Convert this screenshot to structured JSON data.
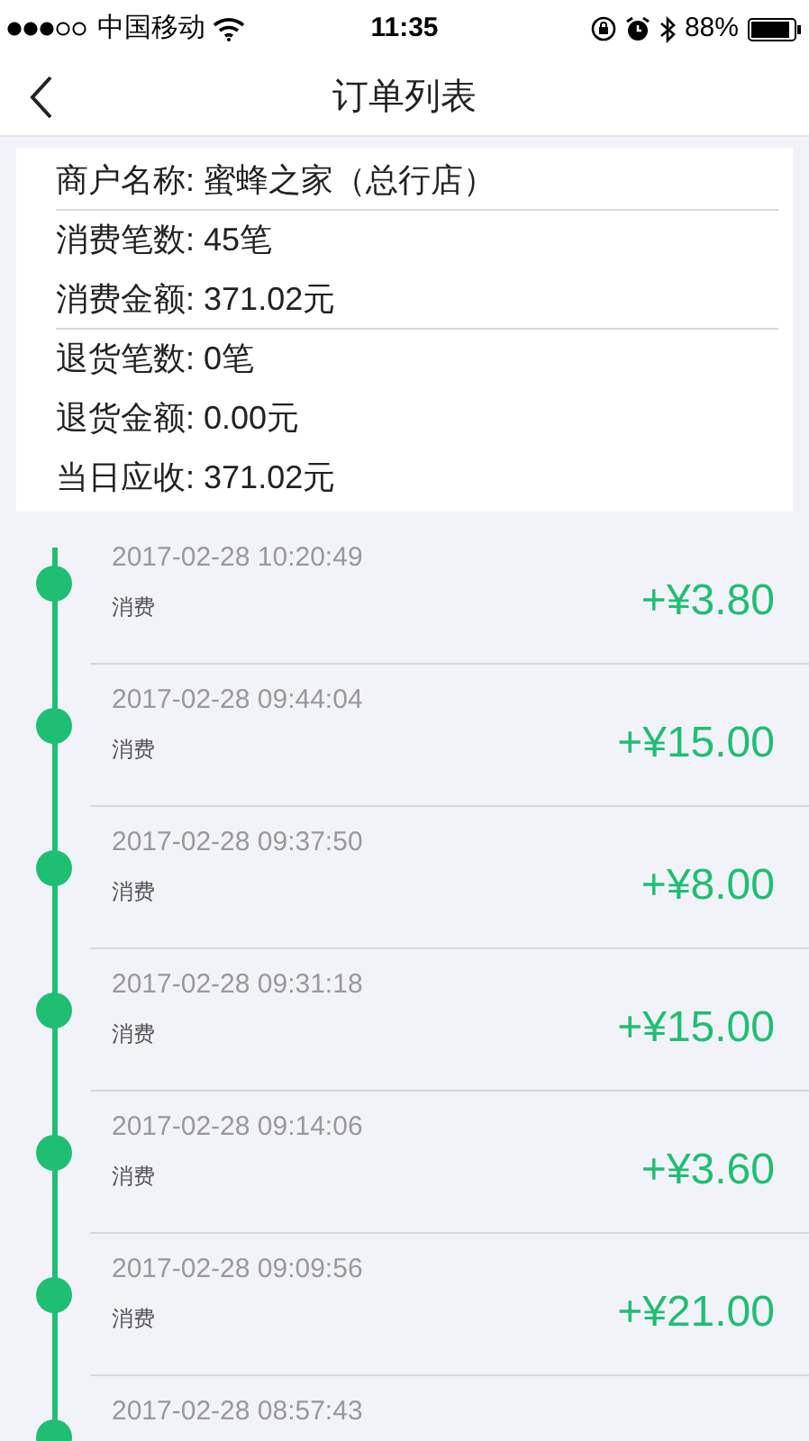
{
  "status_bar": {
    "carrier": "中国移动",
    "time": "11:35",
    "battery": "88%"
  },
  "nav": {
    "title": "订单列表"
  },
  "summary": [
    {
      "label": "商户名称:",
      "value": "蜜蜂之家（总行店）",
      "divider_after": true
    },
    {
      "label": "消费笔数:",
      "value": "45笔",
      "divider_after": false
    },
    {
      "label": "消费金额:",
      "value": "371.02元",
      "divider_after": true
    },
    {
      "label": "退货笔数:",
      "value": "0笔",
      "divider_after": false
    },
    {
      "label": "退货金额:",
      "value": "0.00元",
      "divider_after": false
    },
    {
      "label": "当日应收:",
      "value": "371.02元",
      "divider_after": false
    }
  ],
  "orders": [
    {
      "time": "2017-02-28 10:20:49",
      "type": "消费",
      "amount": "+¥3.80"
    },
    {
      "time": "2017-02-28 09:44:04",
      "type": "消费",
      "amount": "+¥15.00"
    },
    {
      "time": "2017-02-28 09:37:50",
      "type": "消费",
      "amount": "+¥8.00"
    },
    {
      "time": "2017-02-28 09:31:18",
      "type": "消费",
      "amount": "+¥15.00"
    },
    {
      "time": "2017-02-28 09:14:06",
      "type": "消费",
      "amount": "+¥3.60"
    },
    {
      "time": "2017-02-28 09:09:56",
      "type": "消费",
      "amount": "+¥21.00"
    },
    {
      "time": "2017-02-28 08:57:43"
    }
  ]
}
